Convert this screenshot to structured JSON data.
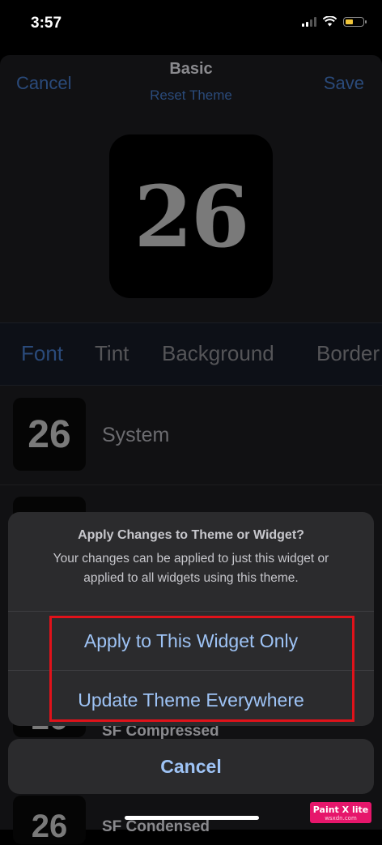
{
  "status_bar": {
    "time": "3:57",
    "battery_level": 0.45,
    "battery_color": "#f0c53a"
  },
  "nav": {
    "cancel_label": "Cancel",
    "title": "Basic",
    "reset_label": "Reset Theme",
    "save_label": "Save"
  },
  "preview": {
    "value": "26"
  },
  "tabs": [
    {
      "label": "Font",
      "selected": true
    },
    {
      "label": "Tint",
      "selected": false
    },
    {
      "label": "Background",
      "selected": false
    },
    {
      "label": "Border",
      "selected": false
    }
  ],
  "font_list": [
    {
      "sample": "26",
      "name": "System"
    },
    {
      "sample": "26",
      "name": "SF Compressed"
    },
    {
      "sample": "26",
      "name": "SF Condensed"
    }
  ],
  "alert": {
    "title": "Apply Changes to Theme or Widget?",
    "message": "Your changes can be applied to just this widget or applied to all widgets using this theme.",
    "actions": [
      "Apply to This Widget Only",
      "Update Theme Everywhere"
    ],
    "cancel_label": "Cancel"
  },
  "watermark": {
    "main": "Paint X lite",
    "sub": "wsxdn.com"
  },
  "colors": {
    "accent": "#9ec3f5",
    "highlight_box": "#e0121a",
    "dimmed_accent": "#2a4a7a"
  }
}
